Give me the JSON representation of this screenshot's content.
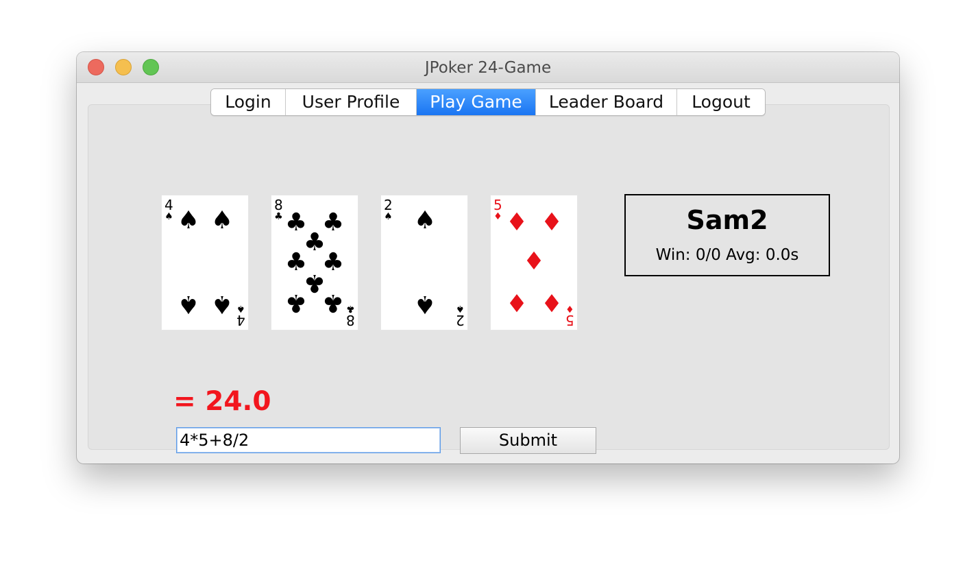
{
  "window": {
    "title": "JPoker 24-Game"
  },
  "tabs": [
    {
      "label": "Login",
      "active": false
    },
    {
      "label": "User Profile",
      "active": false
    },
    {
      "label": "Play Game",
      "active": true
    },
    {
      "label": "Leader Board",
      "active": false
    },
    {
      "label": "Logout",
      "active": false
    }
  ],
  "cards": [
    {
      "rank": "4",
      "suit": "spades",
      "symbol": "♠",
      "color": "#000000"
    },
    {
      "rank": "8",
      "suit": "clubs",
      "symbol": "♣",
      "color": "#000000"
    },
    {
      "rank": "2",
      "suit": "spades",
      "symbol": "♠",
      "color": "#000000"
    },
    {
      "rank": "5",
      "suit": "diamonds",
      "symbol": "♦",
      "color": "#e8121a"
    }
  ],
  "player": {
    "name": "Sam2",
    "stats": "Win: 0/0 Avg: 0.0s"
  },
  "game": {
    "result": "= 24.0",
    "result_color": "#f2161e",
    "expression": "4*5+8/2",
    "submit_label": "Submit"
  }
}
